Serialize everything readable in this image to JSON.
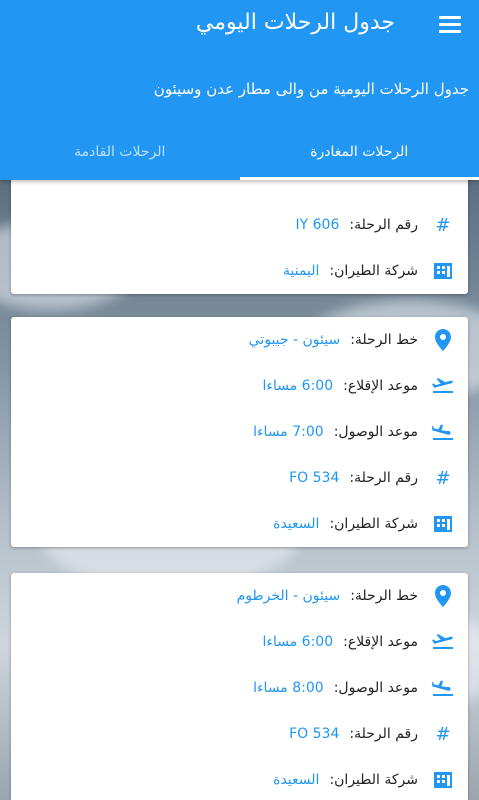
{
  "app": {
    "title": "جدول الرحلات اليومي",
    "subtitle": "جدول الرحلات اليومية من والى مطار عدن وسيئون"
  },
  "tabs": [
    {
      "label": "الرحلات المغادرة",
      "active": true
    },
    {
      "label": "الرحلات القادمة",
      "active": false
    }
  ],
  "labels": {
    "route": "خط الرحلة:",
    "departure": "موعد الإقلاع:",
    "arrival": "موعد الوصول:",
    "flight_no": "رقم الرحلة:",
    "airline": "شركة الطيران:"
  },
  "flights": [
    {
      "flight_no": "IY 606",
      "airline": "اليمنية"
    },
    {
      "route": "سيئون - جيبوتي",
      "departure": "6:00 مساءا",
      "arrival": "7:00 مساءا",
      "flight_no": "FO 534",
      "airline": "السعيدة"
    },
    {
      "route": "سيئون - الخرطوم",
      "departure": "6:00 مساءا",
      "arrival": "8:00 مساءا",
      "flight_no": "FO 534",
      "airline": "السعيدة"
    }
  ],
  "colors": {
    "primary": "#2196f3"
  }
}
